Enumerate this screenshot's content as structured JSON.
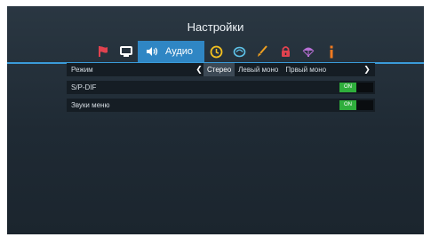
{
  "header": {
    "title": "Настройки"
  },
  "tabs": {
    "items": [
      {
        "icon": "flag-icon",
        "color": "#e0424f"
      },
      {
        "icon": "monitor-icon",
        "color": "#ffffff"
      },
      {
        "icon": "speaker-icon",
        "label": "Аудио",
        "active": true
      },
      {
        "icon": "clock-icon",
        "color": "#f3c020"
      },
      {
        "icon": "satellite-dish-icon",
        "color": "#5ec2e8"
      },
      {
        "icon": "brush-icon",
        "color": "#f0a020"
      },
      {
        "icon": "lock-icon",
        "color": "#e0424f"
      },
      {
        "icon": "parachute-icon",
        "color": "#b66fd3"
      },
      {
        "icon": "info-icon",
        "color": "#f07a20"
      }
    ]
  },
  "settings": {
    "mode": {
      "label": "Режим",
      "options": [
        "Стерео",
        "Левый моно",
        "Првый моно"
      ],
      "selected": "Стерео"
    },
    "spdif": {
      "label": "S/P-DIF",
      "toggle": "ON"
    },
    "menu_sounds": {
      "label": "Звуки меню",
      "toggle": "ON"
    }
  },
  "colors": {
    "accent": "#2f86c4",
    "toggle_on": "#2fae3c"
  }
}
